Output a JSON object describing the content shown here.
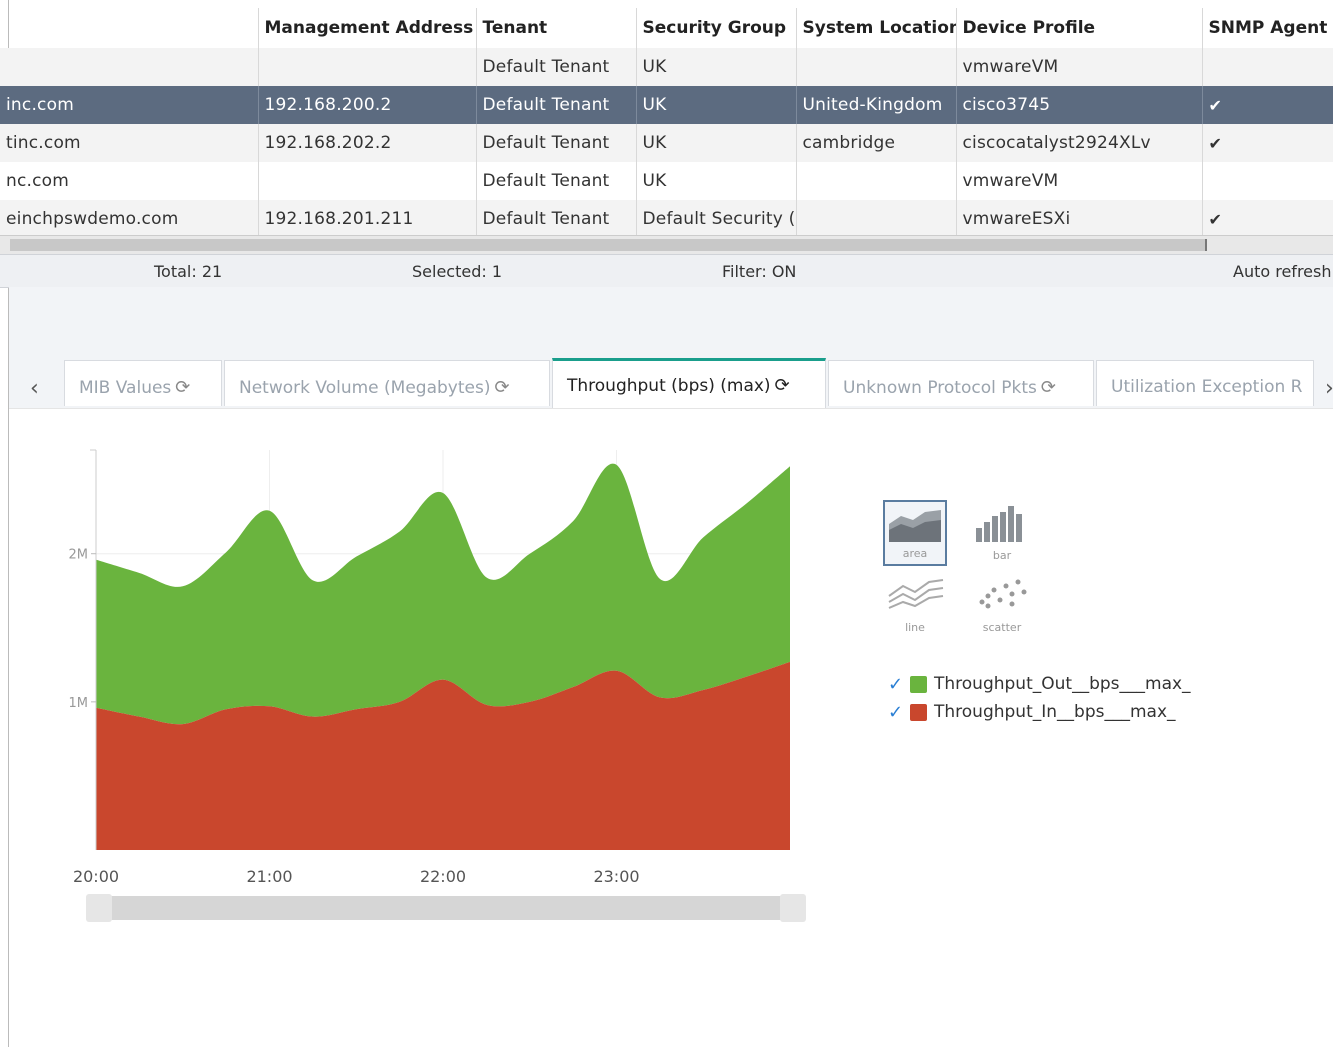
{
  "table": {
    "columns": [
      "",
      "Management Address",
      "Tenant",
      "Security Group",
      "System Location",
      "Device Profile",
      "SNMP Agent E"
    ],
    "rows": [
      [
        "",
        "",
        "Default Tenant",
        "UK",
        "",
        "vmwareVM",
        ""
      ],
      [
        "inc.com",
        "192.168.200.2",
        "Default Tenant",
        "UK",
        "United-Kingdom",
        "cisco3745",
        "✔"
      ],
      [
        "tinc.com",
        "192.168.202.2",
        "Default Tenant",
        "UK",
        "cambridge",
        "ciscocatalyst2924XLv",
        "✔"
      ],
      [
        "nc.com",
        "",
        "Default Tenant",
        "UK",
        "",
        "vmwareVM",
        ""
      ],
      [
        "einchpswdemo.com",
        "192.168.201.211",
        "Default Tenant",
        "Default Security (",
        "",
        "vmwareESXi",
        "✔"
      ]
    ]
  },
  "status": {
    "total": "Total: 21",
    "selected": "Selected: 1",
    "filter": "Filter: ON",
    "auto_refresh": "Auto refresh"
  },
  "tabs": [
    {
      "label": "MIB Values",
      "active": false
    },
    {
      "label": "Network Volume (Megabytes)",
      "active": false
    },
    {
      "label": "Throughput (bps) (max)",
      "active": true
    },
    {
      "label": "Unknown Protocol Pkts",
      "active": false
    },
    {
      "label": "Utilization Exception R",
      "active": false
    }
  ],
  "icons": {
    "tab_left": "chevron-left-icon",
    "tab_right": "chevron-right-icon",
    "refresh": "refresh-icon",
    "check": "checkmark-icon"
  },
  "chart_types": [
    "area",
    "bar",
    "line",
    "scatter"
  ],
  "legend": [
    {
      "name": "Throughput_Out__bps___max_",
      "color": "#6ab43e"
    },
    {
      "name": "Throughput_In__bps___max_",
      "color": "#c9472d"
    }
  ],
  "chart_data": {
    "type": "area",
    "stacked": true,
    "x": [
      "20:00",
      "20:15",
      "20:30",
      "20:45",
      "21:00",
      "21:15",
      "21:30",
      "21:45",
      "22:00",
      "22:15",
      "22:30",
      "22:45",
      "23:00",
      "23:15",
      "23:30",
      "23:45",
      "24:00"
    ],
    "x_ticks": [
      "20:00",
      "21:00",
      "22:00",
      "23:00"
    ],
    "y_ticks": [
      "1M",
      "2M"
    ],
    "ylim": [
      0,
      2700000
    ],
    "series": [
      {
        "name": "Throughput_In__bps___max_",
        "color": "#c9472d",
        "values": [
          960000,
          900000,
          850000,
          950000,
          970000,
          900000,
          950000,
          1000000,
          1150000,
          980000,
          1000000,
          1100000,
          1210000,
          1030000,
          1080000,
          1170000,
          1270000
        ]
      },
      {
        "name": "Throughput_Out__bps___max_",
        "color": "#6ab43e",
        "values": [
          1000000,
          970000,
          930000,
          1060000,
          1320000,
          920000,
          1030000,
          1150000,
          1260000,
          860000,
          1000000,
          1120000,
          1390000,
          800000,
          1030000,
          1170000,
          1320000
        ]
      }
    ]
  }
}
